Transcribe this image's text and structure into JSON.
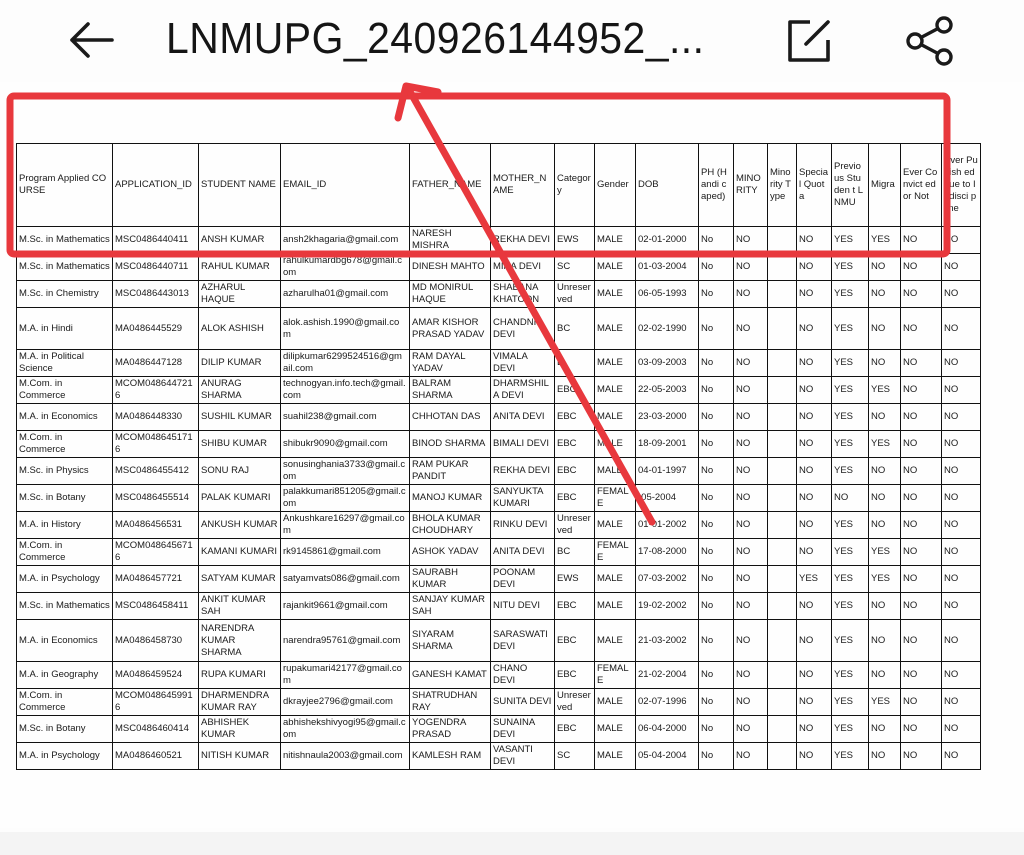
{
  "header": {
    "title": "LNMUPG_240926144952_...",
    "back_icon": "arrow-left-icon",
    "edit_icon": "edit-square-icon",
    "share_icon": "share-icon"
  },
  "annotation": {
    "highlight_box_color": "#e8383d",
    "arrow_color": "#e8383d",
    "highlight_target": "header row and first data row",
    "arrow_points_to": "document title"
  },
  "table": {
    "columns": [
      "Program Applied COURSE",
      "APPLICATION_ID",
      "STUDENT NAME",
      "EMAIL_ID",
      "FATHER_NAME",
      "MOTHER_N AME",
      "Categor y",
      "Gender",
      "DOB",
      "PH (Handi caped)",
      "MINO RITY",
      "Mino rity Type",
      "Specia l Quota",
      "Previo us Studen t LNMU",
      "Migra",
      "Ever Convict ed or Not",
      "Ever Punish ed due to Indisci pline"
    ],
    "rows": [
      [
        "M.Sc. in Mathematics",
        "MSC0486440411",
        "ANSH KUMAR",
        "ansh2khagaria@gmail.com",
        "NARESH MISHRA",
        "REKHA DEVI",
        "EWS",
        "MALE",
        "02-01-2000",
        "No",
        "NO",
        "",
        "NO",
        "YES",
        "YES",
        "NO",
        "NO"
      ],
      [
        "M.Sc. in Mathematics",
        "MSC0486440711",
        "RAHUL KUMAR",
        "rahulkumardbg678@gmail.com",
        "DINESH MAHTO",
        "MINA DEVI",
        "SC",
        "MALE",
        "01-03-2004",
        "No",
        "NO",
        "",
        "NO",
        "YES",
        "NO",
        "NO",
        "NO"
      ],
      [
        "M.Sc. in Chemistry",
        "MSC0486443013",
        "AZHARUL HAQUE",
        "azharulha01@gmail.com",
        "MD MONIRUL HAQUE",
        "SHABANA KHATOON",
        "Unreserved",
        "MALE",
        "06-05-1993",
        "No",
        "NO",
        "",
        "NO",
        "YES",
        "NO",
        "NO",
        "NO"
      ],
      [
        "M.A. in Hindi",
        "MA0486445529",
        "ALOK ASHISH",
        "alok.ashish.1990@gmail.com",
        "AMAR KISHOR PRASAD YADAV",
        "CHANDNI DEVI",
        "BC",
        "MALE",
        "02-02-1990",
        "No",
        "NO",
        "",
        "NO",
        "YES",
        "NO",
        "NO",
        "NO"
      ],
      [
        "M.A. in Political Science",
        "MA0486447128",
        "DILIP KUMAR",
        "dilipkumar6299524516@gmail.com",
        "RAM DAYAL YADAV",
        "VIMALA DEVI",
        "E",
        "MALE",
        "03-09-2003",
        "No",
        "NO",
        "",
        "NO",
        "YES",
        "NO",
        "NO",
        "NO"
      ],
      [
        "M.Com. in Commerce",
        "MCOM0486447216",
        "ANURAG SHARMA",
        "technogyan.info.tech@gmail.com",
        "BALRAM SHARMA",
        "DHARMSHILA DEVI",
        "EBC",
        "MALE",
        "22-05-2003",
        "No",
        "NO",
        "",
        "NO",
        "YES",
        "YES",
        "NO",
        "NO"
      ],
      [
        "M.A. in Economics",
        "MA0486448330",
        "SUSHIL KUMAR",
        "suahil238@gmail.com",
        "CHHOTAN DAS",
        "ANITA DEVI",
        "EBC",
        "MALE",
        "23-03-2000",
        "No",
        "NO",
        "",
        "NO",
        "YES",
        "NO",
        "NO",
        "NO"
      ],
      [
        "M.Com. in Commerce",
        "MCOM0486451716",
        "SHIBU KUMAR",
        "shibukr9090@gmail.com",
        "BINOD SHARMA",
        "BIMALI DEVI",
        "EBC",
        "MALE",
        "18-09-2001",
        "No",
        "NO",
        "",
        "NO",
        "YES",
        "YES",
        "NO",
        "NO"
      ],
      [
        "M.Sc. in Physics",
        "MSC0486455412",
        "SONU RAJ",
        "sonusinghania3733@gmail.com",
        "RAM PUKAR PANDIT",
        "REKHA DEVI",
        "EBC",
        "MALE",
        "04-01-1997",
        "No",
        "NO",
        "",
        "NO",
        "YES",
        "NO",
        "NO",
        "NO"
      ],
      [
        "M.Sc. in Botany",
        "MSC0486455514",
        "PALAK KUMARI",
        "palakkumari851205@gmail.com",
        "MANOJ KUMAR",
        "SANYUKTA KUMARI",
        "EBC",
        "FEMALE",
        "-05-2004",
        "No",
        "NO",
        "",
        "NO",
        "NO",
        "NO",
        "NO",
        "NO"
      ],
      [
        "M.A. in History",
        "MA0486456531",
        "ANKUSH KUMAR",
        "Ankushkare16297@gmail.com",
        "BHOLA KUMAR CHOUDHARY",
        "RINKU DEVI",
        "Unreserved",
        "MALE",
        "01-01-2002",
        "No",
        "NO",
        "",
        "NO",
        "YES",
        "NO",
        "NO",
        "NO"
      ],
      [
        "M.Com. in Commerce",
        "MCOM0486456716",
        "KAMANI KUMARI",
        "rk9145861@gmail.com",
        "ASHOK YADAV",
        "ANITA DEVI",
        "BC",
        "FEMALE",
        "17-08-2000",
        "No",
        "NO",
        "",
        "NO",
        "YES",
        "YES",
        "NO",
        "NO"
      ],
      [
        "M.A. in Psychology",
        "MA0486457721",
        "SATYAM KUMAR",
        "satyamvats086@gmail.com",
        "SAURABH KUMAR",
        "POONAM DEVI",
        "EWS",
        "MALE",
        "07-03-2002",
        "No",
        "NO",
        "",
        "YES",
        "YES",
        "YES",
        "NO",
        "NO"
      ],
      [
        "M.Sc. in Mathematics",
        "MSC0486458411",
        "ANKIT KUMAR SAH",
        "rajankit9661@gmail.com",
        "SANJAY KUMAR SAH",
        "NITU DEVI",
        "EBC",
        "MALE",
        "19-02-2002",
        "No",
        "NO",
        "",
        "NO",
        "YES",
        "NO",
        "NO",
        "NO"
      ],
      [
        "M.A. in Economics",
        "MA0486458730",
        "NARENDRA KUMAR SHARMA",
        "narendra95761@gmail.com",
        "SIYARAM SHARMA",
        "SARASWATI DEVI",
        "EBC",
        "MALE",
        "21-03-2002",
        "No",
        "NO",
        "",
        "NO",
        "YES",
        "NO",
        "NO",
        "NO"
      ],
      [
        "M.A. in Geography",
        "MA0486459524",
        "RUPA KUMARI",
        "rupakumari42177@gmail.com",
        "GANESH KAMAT",
        "CHANO DEVI",
        "EBC",
        "FEMALE",
        "21-02-2004",
        "No",
        "NO",
        "",
        "NO",
        "YES",
        "NO",
        "NO",
        "NO"
      ],
      [
        "M.Com. in Commerce",
        "MCOM0486459916",
        "DHARMENDRA KUMAR RAY",
        "dkrayjee2796@gmail.com",
        "SHATRUDHAN RAY",
        "SUNITA DEVI",
        "Unreserved",
        "MALE",
        "02-07-1996",
        "No",
        "NO",
        "",
        "NO",
        "YES",
        "YES",
        "NO",
        "NO"
      ],
      [
        "M.Sc. in Botany",
        "MSC0486460414",
        "ABHISHEK KUMAR",
        "abhishekshivyogi95@gmail.com",
        "YOGENDRA PRASAD",
        "SUNAINA DEVI",
        "EBC",
        "MALE",
        "06-04-2000",
        "No",
        "NO",
        "",
        "NO",
        "YES",
        "NO",
        "NO",
        "NO"
      ],
      [
        "M.A. in Psychology",
        "MA0486460521",
        "NITISH KUMAR",
        "nitishnaula2003@gmail.com",
        "KAMLESH RAM",
        "VASANTI DEVI",
        "SC",
        "MALE",
        "05-04-2004",
        "No",
        "NO",
        "",
        "NO",
        "YES",
        "NO",
        "NO",
        "NO"
      ]
    ]
  }
}
